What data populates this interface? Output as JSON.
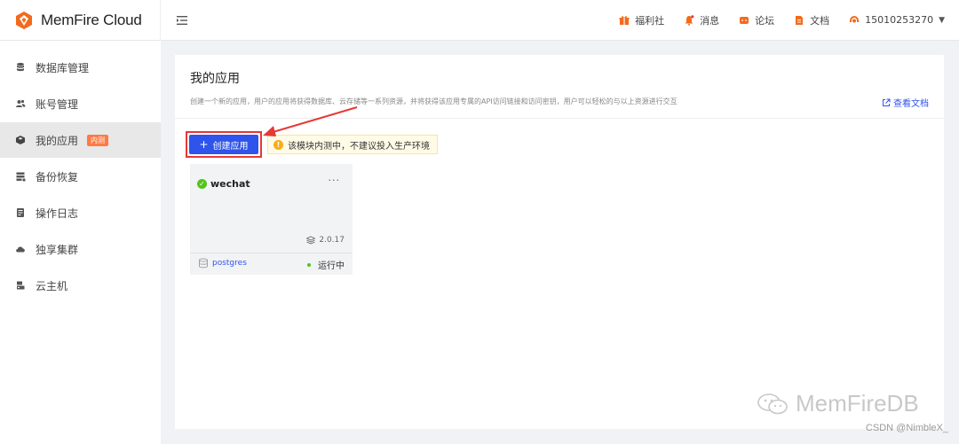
{
  "brand": {
    "name": "MemFire Cloud",
    "logo_icon": "fox-logo-icon",
    "accent": "#f26b1d"
  },
  "topnav": {
    "items": [
      {
        "label": "福利社",
        "icon": "gift-icon"
      },
      {
        "label": "消息",
        "icon": "bell-icon"
      },
      {
        "label": "论坛",
        "icon": "chat-icon"
      },
      {
        "label": "文档",
        "icon": "document-icon"
      }
    ],
    "user": {
      "phone": "15010253270",
      "icon": "user-icon"
    }
  },
  "sidebar": {
    "items": [
      {
        "label": "数据库管理",
        "icon": "database-icon"
      },
      {
        "label": "账号管理",
        "icon": "users-icon"
      },
      {
        "label": "我的应用",
        "icon": "cube-icon",
        "active": true,
        "badge": "内测"
      },
      {
        "label": "备份恢复",
        "icon": "backup-icon"
      },
      {
        "label": "操作日志",
        "icon": "log-icon"
      },
      {
        "label": "独享集群",
        "icon": "cloud-icon"
      },
      {
        "label": "云主机",
        "icon": "server-icon"
      }
    ]
  },
  "main": {
    "title": "我的应用",
    "description": "创建一个新的应用，用户的应用将获得数据库、云存储等一系列资源，并将获得该应用专属的API访问链接和访问密钥，用户可以轻松的与以上资源进行交互",
    "doc_link": "查看文档",
    "create_button": "创建应用",
    "warning": "该模块内测中，不建议投入生产环境"
  },
  "app_card": {
    "name": "wechat",
    "status_icon": "check-circle-icon",
    "more": "···",
    "version": "2.0.17",
    "database": "postgres",
    "status": "运行中",
    "status_color": "#52c41a"
  },
  "colors": {
    "primary": "#2f54eb",
    "highlight_box": "#e53935",
    "badge": "#ff7a45"
  },
  "watermark": {
    "main": "MemFireDB",
    "credit": "CSDN @NimbleX_"
  }
}
